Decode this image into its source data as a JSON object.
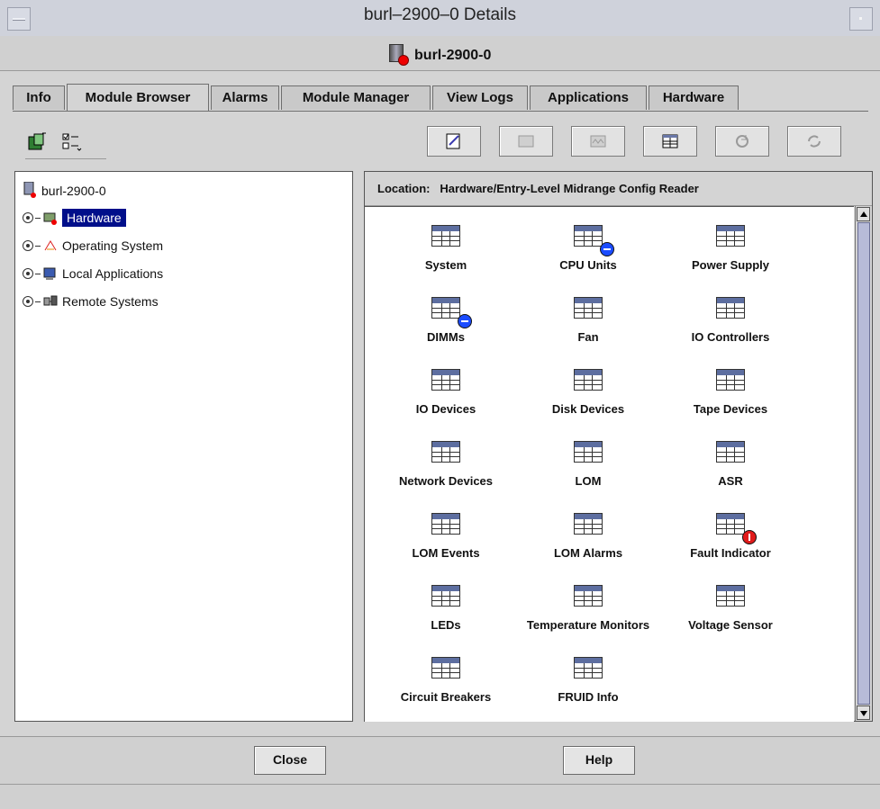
{
  "window": {
    "title": "burl–2900–0 Details"
  },
  "host": {
    "name": "burl-2900-0"
  },
  "tabs": [
    {
      "label": "Info"
    },
    {
      "label": "Module Browser"
    },
    {
      "label": "Alarms"
    },
    {
      "label": "Module Manager"
    },
    {
      "label": "View Logs"
    },
    {
      "label": "Applications"
    },
    {
      "label": "Hardware"
    }
  ],
  "tree": {
    "root": "burl-2900-0",
    "items": [
      {
        "label": "Hardware"
      },
      {
        "label": "Operating System"
      },
      {
        "label": "Local Applications"
      },
      {
        "label": "Remote Systems"
      }
    ]
  },
  "location": {
    "label": "Location:",
    "path": "Hardware/Entry-Level Midrange Config Reader"
  },
  "modules": [
    {
      "label": "System"
    },
    {
      "label": "CPU Units"
    },
    {
      "label": "Power Supply"
    },
    {
      "label": "DIMMs"
    },
    {
      "label": "Fan"
    },
    {
      "label": "IO Controllers"
    },
    {
      "label": "IO Devices"
    },
    {
      "label": "Disk Devices"
    },
    {
      "label": "Tape Devices"
    },
    {
      "label": "Network Devices"
    },
    {
      "label": "LOM"
    },
    {
      "label": "ASR"
    },
    {
      "label": "LOM Events"
    },
    {
      "label": "LOM Alarms"
    },
    {
      "label": "Fault Indicator"
    },
    {
      "label": "LEDs"
    },
    {
      "label": "Temperature Monitors"
    },
    {
      "label": "Voltage Sensor"
    },
    {
      "label": "Circuit Breakers"
    },
    {
      "label": "FRUID Info"
    }
  ],
  "buttons": {
    "close": "Close",
    "help": "Help"
  }
}
